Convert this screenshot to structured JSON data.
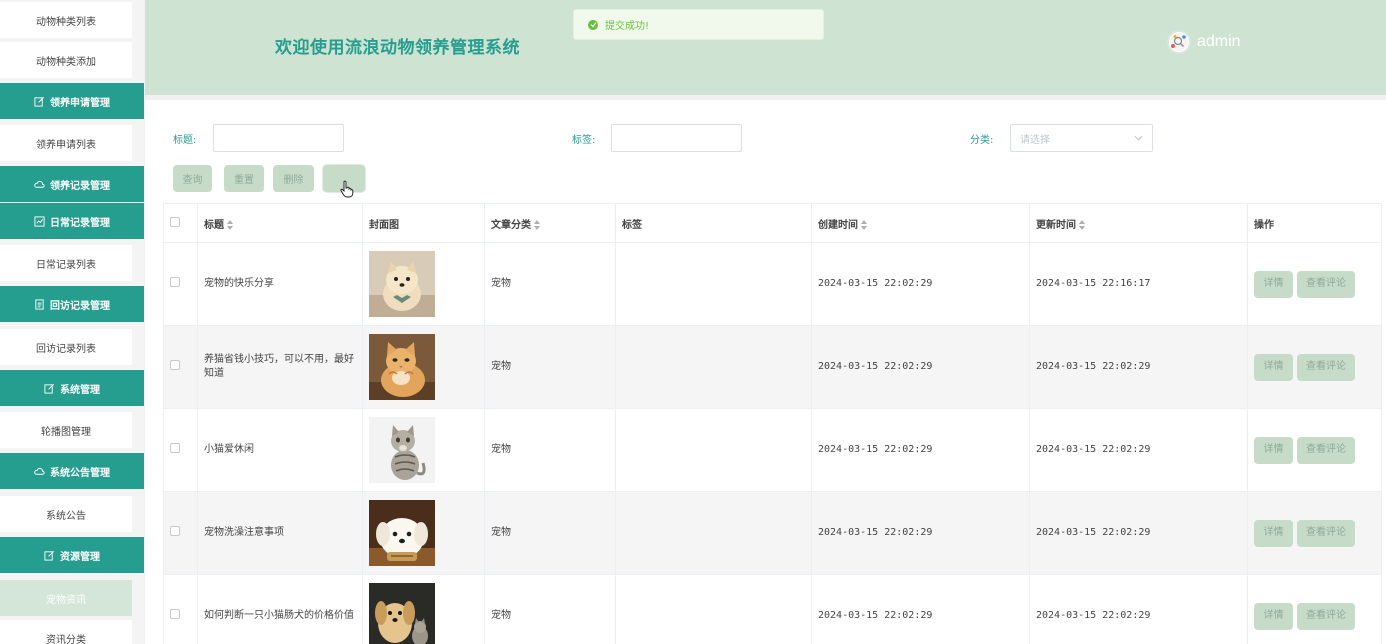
{
  "header": {
    "title": "欢迎使用流浪动物领养管理系统",
    "username": "admin",
    "toast": "提交成功!"
  },
  "sidebar": {
    "items": [
      {
        "label": "动物种类列表",
        "kind": "sub"
      },
      {
        "label": "动物种类添加",
        "kind": "sub"
      },
      {
        "label": "领养申请管理",
        "kind": "head",
        "icon": "edit-icon"
      },
      {
        "label": "领养申请列表",
        "kind": "sub"
      },
      {
        "label": "领养记录管理",
        "kind": "head",
        "icon": "cloud-icon"
      },
      {
        "label": "日常记录管理",
        "kind": "head",
        "icon": "chart-icon"
      },
      {
        "label": "日常记录列表",
        "kind": "sub"
      },
      {
        "label": "回访记录管理",
        "kind": "head",
        "icon": "document-icon"
      },
      {
        "label": "回访记录列表",
        "kind": "sub"
      },
      {
        "label": "系统管理",
        "kind": "head",
        "icon": "edit-icon"
      },
      {
        "label": "轮播图管理",
        "kind": "sub"
      },
      {
        "label": "系统公告管理",
        "kind": "head",
        "icon": "cloud-icon"
      },
      {
        "label": "系统公告",
        "kind": "sub"
      },
      {
        "label": "资源管理",
        "kind": "head",
        "icon": "edit-icon"
      },
      {
        "label": "宠物资讯",
        "kind": "sub",
        "active": true
      },
      {
        "label": "资讯分类",
        "kind": "sub"
      }
    ]
  },
  "filters": {
    "title_label": "标题:",
    "tag_label": "标签:",
    "category_label": "分类:",
    "category_placeholder": "请选择"
  },
  "actions": {
    "query": "查询",
    "reset": "重置",
    "delete": "删除",
    "extra": ""
  },
  "table": {
    "headers": {
      "title": "标题",
      "cover": "封面图",
      "category": "文章分类",
      "tags": "标签",
      "created": "创建时间",
      "updated": "更新时间",
      "ops": "操作"
    },
    "row_buttons": {
      "detail": "详情",
      "comments": "查看评论"
    },
    "rows": [
      {
        "title": "宠物的快乐分享",
        "category": "宠物",
        "tags": "",
        "created": "2024-03-15 22:02:29",
        "updated": "2024-03-15 22:16:17"
      },
      {
        "title": "养猫省钱小技巧，可以不用，最好知道",
        "category": "宠物",
        "tags": "",
        "created": "2024-03-15 22:02:29",
        "updated": "2024-03-15 22:02:29"
      },
      {
        "title": "小猫爱休闲",
        "category": "宠物",
        "tags": "",
        "created": "2024-03-15 22:02:29",
        "updated": "2024-03-15 22:02:29"
      },
      {
        "title": "宠物洗澡注意事项",
        "category": "宠物",
        "tags": "",
        "created": "2024-03-15 22:02:29",
        "updated": "2024-03-15 22:02:29"
      },
      {
        "title": "如何判断一只小猫肠犬的价格价值",
        "category": "宠物",
        "tags": "",
        "created": "2024-03-15 22:02:29",
        "updated": "2024-03-15 22:02:29"
      }
    ]
  },
  "colors": {
    "accent": "#259e8f",
    "header_bg": "#cfe3d2",
    "button_bg": "#c6dcc9",
    "success": "#67c23a"
  }
}
